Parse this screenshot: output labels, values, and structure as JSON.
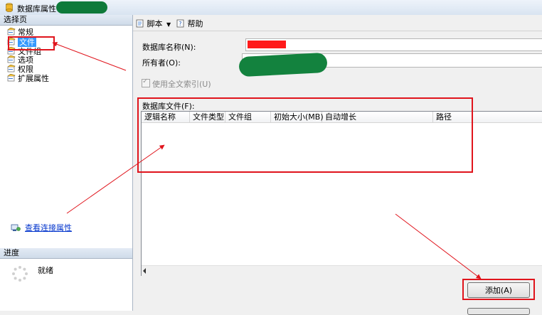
{
  "window": {
    "title": "数据库属性"
  },
  "left_pane": {
    "header": "选择页",
    "items": [
      {
        "label": "常规",
        "icon": "page-icon",
        "selected": false
      },
      {
        "label": "文件",
        "icon": "page-icon",
        "selected": true
      },
      {
        "label": "文件组",
        "icon": "page-icon",
        "selected": false
      },
      {
        "label": "选项",
        "icon": "page-icon",
        "selected": false
      },
      {
        "label": "权限",
        "icon": "page-icon",
        "selected": false
      },
      {
        "label": "扩展属性",
        "icon": "page-icon",
        "selected": false
      }
    ],
    "connection_link": "查看连接属性",
    "progress_header": "进度",
    "progress_status": "就绪"
  },
  "toolbar": {
    "script_label": "脚本",
    "help_label": "帮助"
  },
  "form": {
    "db_name_label": "数据库名称(N):",
    "owner_label": "所有者(O):",
    "fulltext_label": "使用全文索引(U)",
    "db_files_label": "数据库文件(F):"
  },
  "grid": {
    "columns": [
      "逻辑名称",
      "文件类型",
      "文件组",
      "初始大小(MB)",
      "自动增长",
      "路径"
    ]
  },
  "buttons": {
    "add_label": "添加(A)"
  },
  "colors": {
    "annotation_red": "#e0141c",
    "selection_blue": "#3399ff",
    "redaction_green": "#13823e",
    "redaction_red": "#ff1a1a"
  }
}
